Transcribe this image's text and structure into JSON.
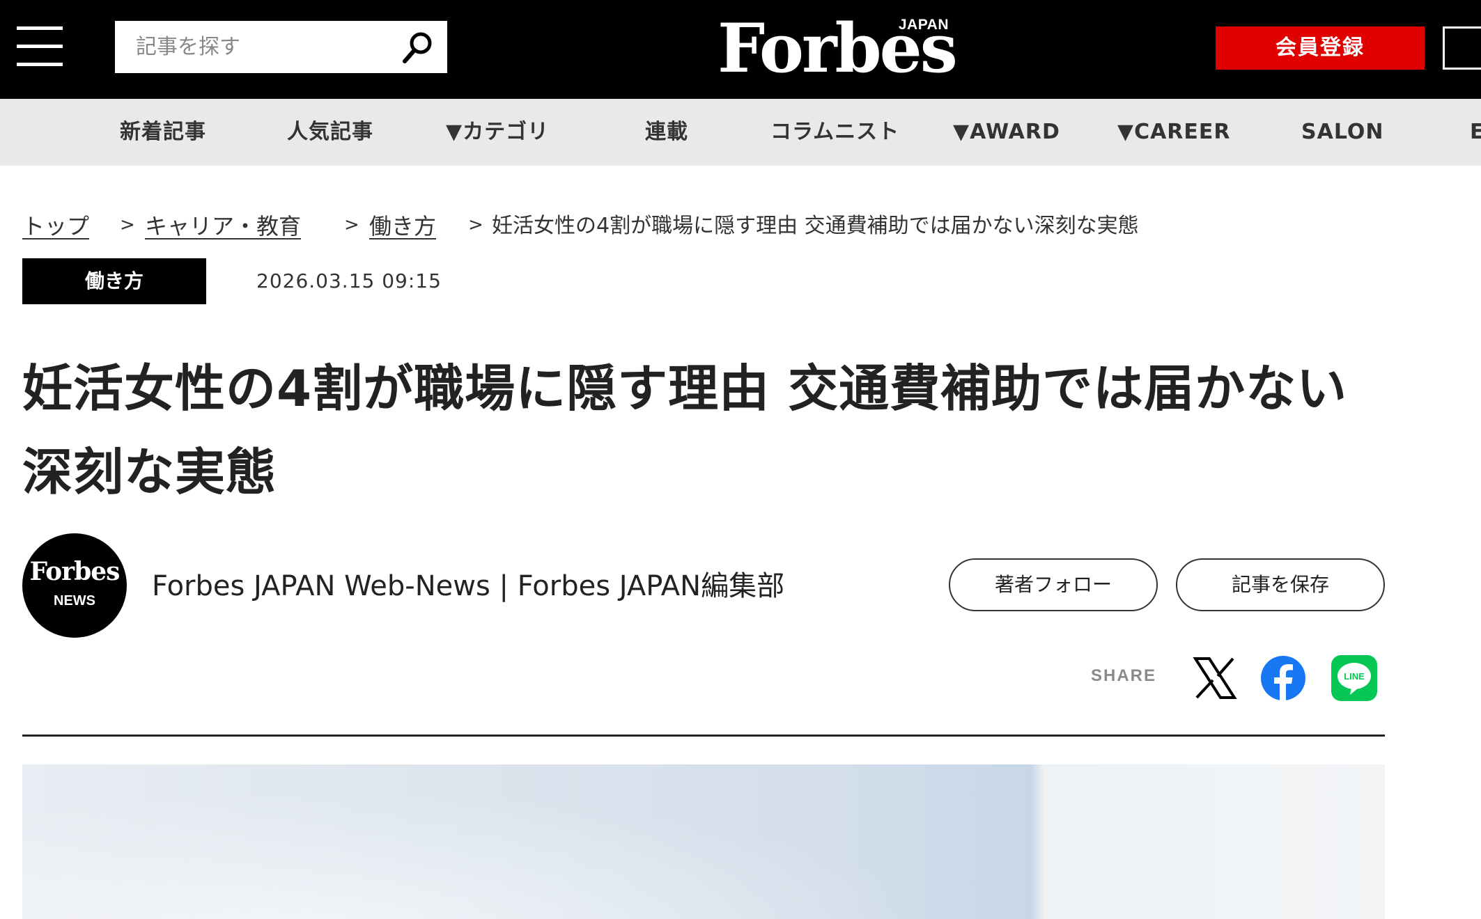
{
  "header": {
    "search_placeholder": "記事を探す",
    "logo_text": "Forbes",
    "logo_sub": "JAPAN",
    "register_label": "会員登録"
  },
  "nav": {
    "items": [
      "新着記事",
      "人気記事",
      "▼カテゴリ",
      "連載",
      "コラムニスト",
      "▼AWARD",
      "▼CAREER",
      "SALON",
      "E"
    ]
  },
  "breadcrumb": {
    "items": [
      "トップ",
      "キャリア・教育",
      "働き方"
    ],
    "current": "妊活女性の4割が職場に隠す理由 交通費補助では届かない深刻な実態",
    "separator": ">"
  },
  "article": {
    "category": "働き方",
    "date": "2026.03.15 09:15",
    "title": "妊活女性の4割が職場に隠す理由 交通費補助では届かない深刻な実態"
  },
  "author": {
    "avatar_logo": "Forbes",
    "avatar_sub": "NEWS",
    "name": "Forbes JAPAN Web-News | Forbes JAPAN編集部",
    "follow_label": "著者フォロー",
    "save_label": "記事を保存"
  },
  "share": {
    "label": "SHARE",
    "icons": [
      "x-icon",
      "facebook-icon",
      "line-icon"
    ],
    "line_text": "LINE"
  },
  "colors": {
    "header_bg": "#000000",
    "nav_bg": "#e9e9e9",
    "register": "#e00000",
    "facebook": "#1877f2",
    "line": "#06c755"
  }
}
